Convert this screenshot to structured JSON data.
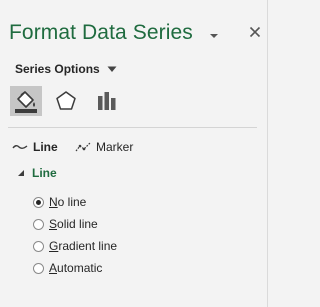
{
  "pane": {
    "title": "Format Data Series",
    "menu_icon": "chevron-down-icon",
    "close_icon": "close-icon"
  },
  "series_options": {
    "label": "Series Options",
    "caret_icon": "caret-down-icon"
  },
  "icon_tabs": [
    {
      "icon": "fill-line-icon",
      "active": true
    },
    {
      "icon": "effects-pentagon-icon",
      "active": false
    },
    {
      "icon": "series-options-bar-icon",
      "active": false
    }
  ],
  "subtabs": {
    "line": {
      "label": "Line",
      "active": true,
      "icon": "line-icon"
    },
    "marker": {
      "label": "Marker",
      "active": false,
      "icon": "marker-icon"
    }
  },
  "line_section": {
    "header": "Line",
    "expanded": true,
    "options": [
      {
        "key": "N",
        "rest": "o line",
        "checked": true
      },
      {
        "key": "S",
        "rest": "olid line",
        "checked": false
      },
      {
        "key": "G",
        "rest": "radient line",
        "checked": false
      },
      {
        "key": "A",
        "rest": "utomatic",
        "checked": false
      }
    ]
  },
  "colors": {
    "accent": "#1f6b3f",
    "pane_bg": "#f3f3f3",
    "active_tab_bg": "#c6c6c6"
  }
}
